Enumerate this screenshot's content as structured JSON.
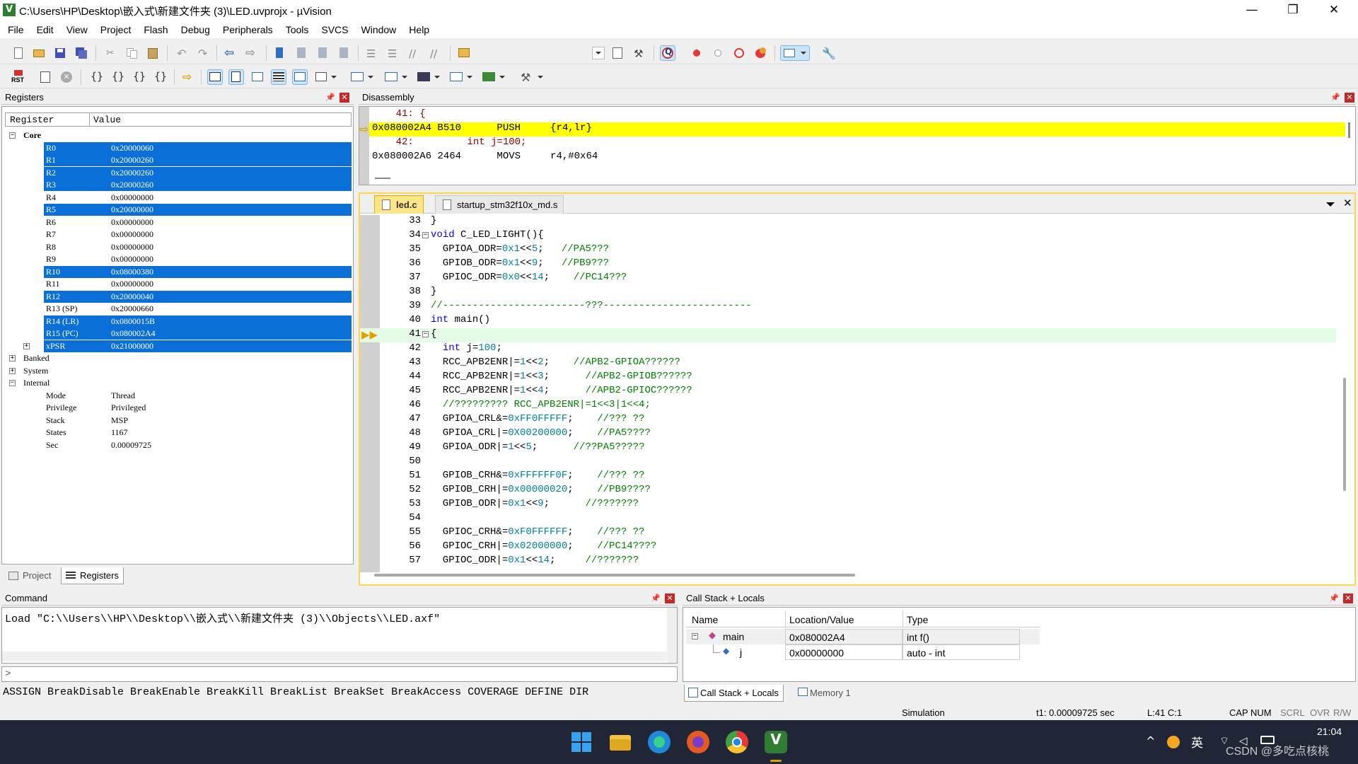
{
  "window": {
    "title": "C:\\Users\\HP\\Desktop\\嵌入式\\新建文件夹 (3)\\LED.uvprojx - µVision",
    "icon_letter": "V",
    "controls": {
      "minimize": "—",
      "maximize": "❐",
      "close": "✕"
    }
  },
  "menu": [
    "File",
    "Edit",
    "View",
    "Project",
    "Flash",
    "Debug",
    "Peripherals",
    "Tools",
    "SVCS",
    "Window",
    "Help"
  ],
  "toolbar2": {
    "rst_label": "RST"
  },
  "registers_panel": {
    "title": "Registers",
    "col_register": "Register",
    "col_value": "Value",
    "core_label": "Core",
    "core": [
      {
        "name": "R0",
        "value": "0x20000060",
        "selected": true
      },
      {
        "name": "R1",
        "value": "0x20000260",
        "selected": true
      },
      {
        "name": "R2",
        "value": "0x20000260",
        "selected": true
      },
      {
        "name": "R3",
        "value": "0x20000260",
        "selected": true
      },
      {
        "name": "R4",
        "value": "0x00000000",
        "selected": false
      },
      {
        "name": "R5",
        "value": "0x20000000",
        "selected": true
      },
      {
        "name": "R6",
        "value": "0x00000000",
        "selected": false
      },
      {
        "name": "R7",
        "value": "0x00000000",
        "selected": false
      },
      {
        "name": "R8",
        "value": "0x00000000",
        "selected": false
      },
      {
        "name": "R9",
        "value": "0x00000000",
        "selected": false
      },
      {
        "name": "R10",
        "value": "0x08000380",
        "selected": true
      },
      {
        "name": "R11",
        "value": "0x00000000",
        "selected": false
      },
      {
        "name": "R12",
        "value": "0x20000040",
        "selected": true
      },
      {
        "name": "R13 (SP)",
        "value": "0x20000660",
        "selected": false
      },
      {
        "name": "R14 (LR)",
        "value": "0x0800015B",
        "selected": true
      },
      {
        "name": "R15 (PC)",
        "value": "0x080002A4",
        "selected": true
      },
      {
        "name": "xPSR",
        "value": "0x21000000",
        "selected": true
      }
    ],
    "groups": [
      "Banked",
      "System",
      "Internal"
    ],
    "internal": [
      {
        "name": "Mode",
        "value": "Thread"
      },
      {
        "name": "Privilege",
        "value": "Privileged"
      },
      {
        "name": "Stack",
        "value": "MSP"
      },
      {
        "name": "States",
        "value": "1167"
      },
      {
        "name": "Sec",
        "value": "0.00009725"
      }
    ],
    "tabs": [
      "Project",
      "Registers"
    ]
  },
  "disassembly": {
    "title": "Disassembly",
    "lines": [
      "    41: {",
      "0x080002A4 B510      PUSH     {r4,lr}",
      "    42:         int j=100;",
      "0x080002A6 2464      MOVS     r4,#0x64"
    ]
  },
  "editor": {
    "tabs": [
      "led.c",
      "startup_stm32f10x_md.s"
    ],
    "lines": [
      {
        "n": "33",
        "t": "}"
      },
      {
        "n": "34",
        "t": "void C_LED_LIGHT(){"
      },
      {
        "n": "35",
        "t": "  GPIOA_ODR=0x1<<5;   //PA5???"
      },
      {
        "n": "36",
        "t": "  GPIOB_ODR=0x1<<9;   //PB9???"
      },
      {
        "n": "37",
        "t": "  GPIOC_ODR=0x0<<14;    //PC14???"
      },
      {
        "n": "38",
        "t": "}"
      },
      {
        "n": "39",
        "t": "//------------------------???-------------------------"
      },
      {
        "n": "40",
        "t": "int main()"
      },
      {
        "n": "41",
        "t": "{"
      },
      {
        "n": "42",
        "t": "  int j=100;"
      },
      {
        "n": "43",
        "t": "  RCC_APB2ENR|=1<<2;    //APB2-GPIOA??????"
      },
      {
        "n": "44",
        "t": "  RCC_APB2ENR|=1<<3;      //APB2-GPIOB??????"
      },
      {
        "n": "45",
        "t": "  RCC_APB2ENR|=1<<4;      //APB2-GPIOC??????"
      },
      {
        "n": "46",
        "t": "  //????????? RCC_APB2ENR|=1<<3|1<<4;"
      },
      {
        "n": "47",
        "t": "  GPIOA_CRL&=0xFF0FFFFF;    //??? ??"
      },
      {
        "n": "48",
        "t": "  GPIOA_CRL|=0X00200000;    //PA5????"
      },
      {
        "n": "49",
        "t": "  GPIOA_ODR|=1<<5;      //??PA5?????"
      },
      {
        "n": "50",
        "t": ""
      },
      {
        "n": "51",
        "t": "  GPIOB_CRH&=0xFFFFFF0F;    //??? ??"
      },
      {
        "n": "52",
        "t": "  GPIOB_CRH|=0x00000020;    //PB9????"
      },
      {
        "n": "53",
        "t": "  GPIOB_ODR|=0x1<<9;      //???????"
      },
      {
        "n": "54",
        "t": ""
      },
      {
        "n": "55",
        "t": "  GPIOC_CRH&=0xF0FFFFFF;    //??? ??"
      },
      {
        "n": "56",
        "t": "  GPIOC_CRH|=0x02000000;    //PC14????"
      },
      {
        "n": "57",
        "t": "  GPIOC_ODR|=0x1<<14;     //???????"
      }
    ]
  },
  "command": {
    "title": "Command",
    "output": "Load \"C:\\\\Users\\\\HP\\\\Desktop\\\\嵌入式\\\\新建文件夹 (3)\\\\Objects\\\\LED.axf\"",
    "prompt": ">",
    "hints": "ASSIGN BreakDisable BreakEnable BreakKill BreakList BreakSet BreakAccess COVERAGE DEFINE DIR"
  },
  "callstack": {
    "title": "Call Stack + Locals",
    "columns": [
      "Name",
      "Location/Value",
      "Type"
    ],
    "rows": [
      {
        "name": "main",
        "value": "0x080002A4",
        "type": "int f()"
      },
      {
        "name": "j",
        "value": "0x00000000",
        "type": "auto - int"
      }
    ],
    "tabs": [
      "Call Stack + Locals",
      "Memory 1"
    ]
  },
  "status": {
    "mode": "Simulation",
    "t1": "t1: 0.00009725 sec",
    "pos": "L:41 C:1",
    "keys": [
      "CAP",
      "NUM",
      "SCRL",
      "OVR",
      "R/W"
    ]
  },
  "taskbar": {
    "ime": "英",
    "time": "21:04",
    "watermark": "CSDN @多吃点核桃",
    "chevron": "^"
  },
  "colors": {
    "selection": "#0a6fd6",
    "exec_line": "#ffff00",
    "current_line": "#e6fbe6",
    "keyword": "#0000ff",
    "comment": "#008000",
    "number": "#0080a0",
    "breakpoint": "#e53935",
    "taskbar": "#202636"
  }
}
